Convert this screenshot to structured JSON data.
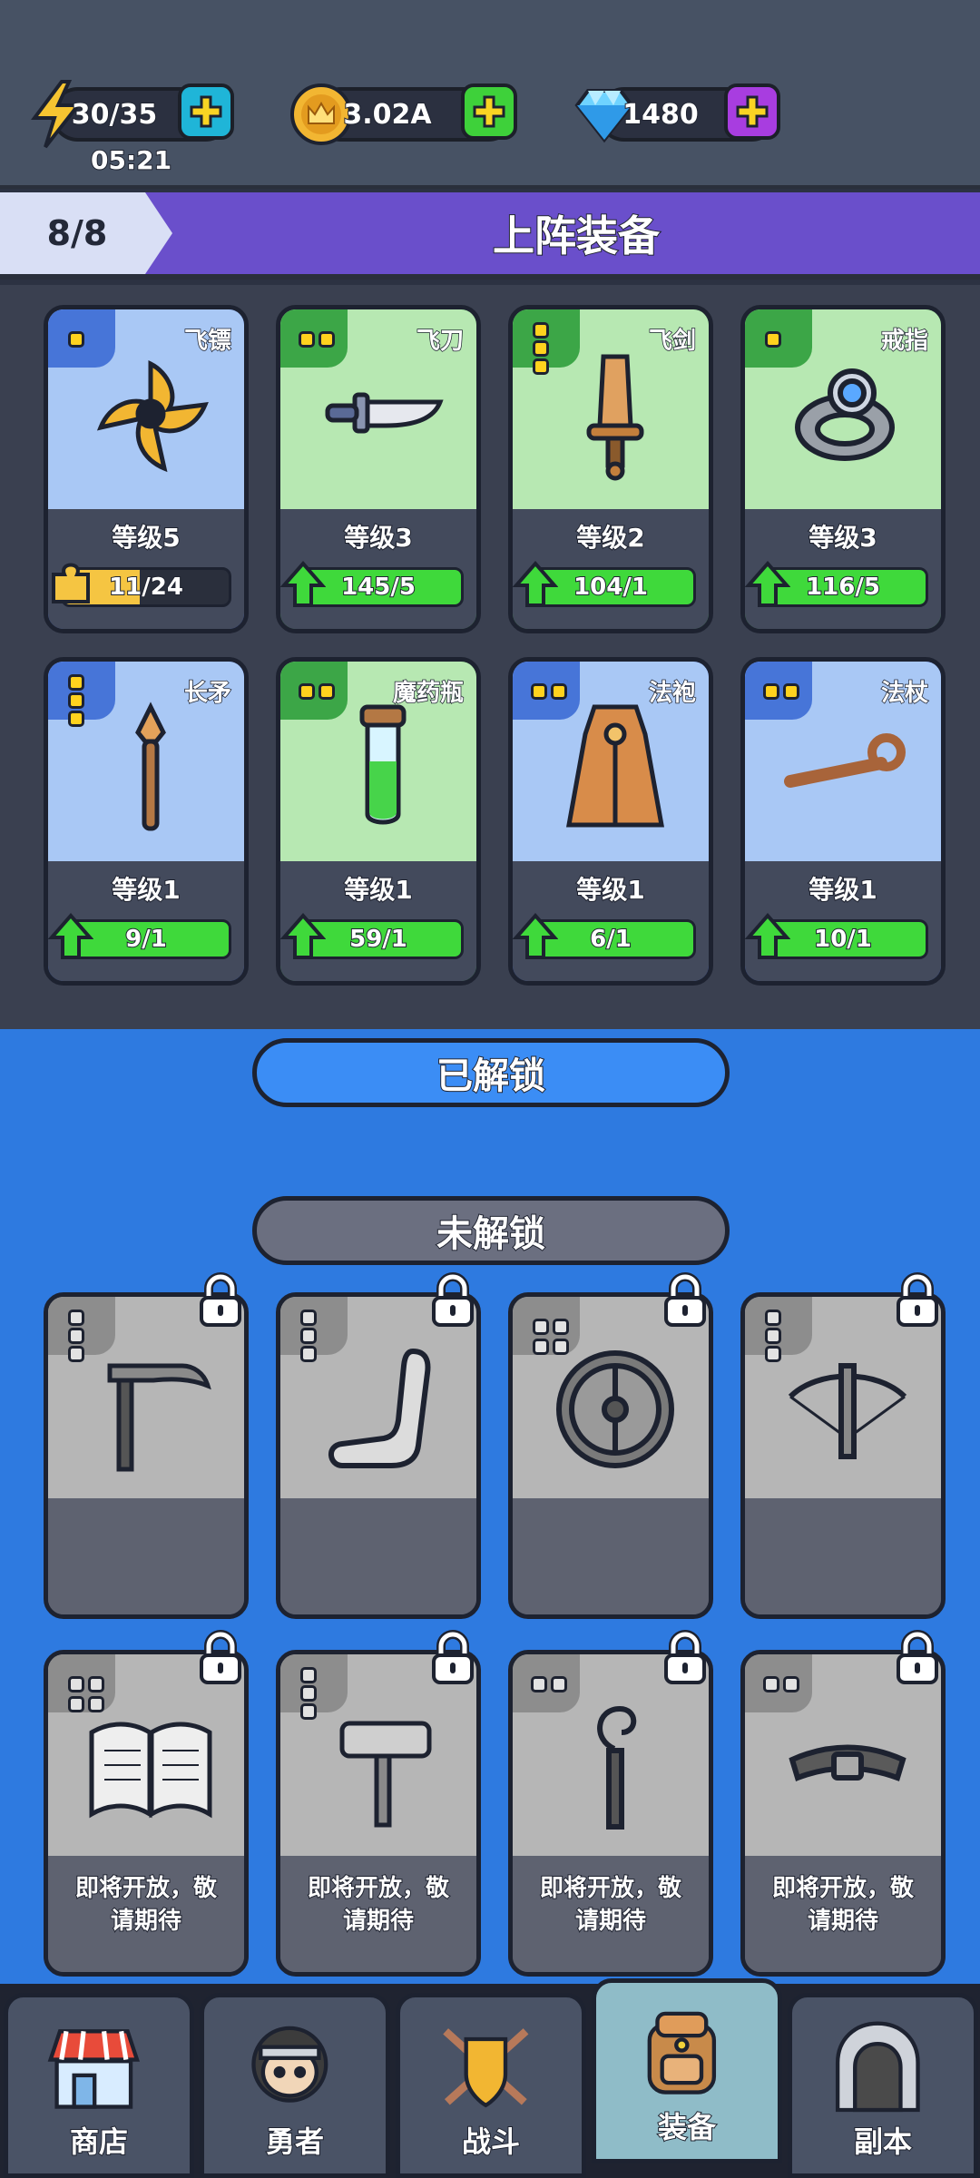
{
  "resources": {
    "energy": {
      "value": "30/35",
      "timer": "05:21",
      "icon": "lightning-icon"
    },
    "gold": {
      "value": "3.02A",
      "icon": "crown-coin-icon"
    },
    "gems": {
      "value": "1480",
      "icon": "diamond-icon"
    }
  },
  "equipped_section": {
    "count": "8/8",
    "title": "上阵装备"
  },
  "equipped_items": [
    {
      "name": "飞镖",
      "level": "等级5",
      "progress": "11/24",
      "progress_fraction": 0.46,
      "rarity": "blue",
      "pips": 1,
      "icon": "shuriken-icon",
      "bar": "yellow"
    },
    {
      "name": "飞刀",
      "level": "等级3",
      "progress": "145/5",
      "progress_fraction": 1.0,
      "rarity": "green",
      "pips": 2,
      "icon": "knife-icon",
      "bar": "green"
    },
    {
      "name": "飞剑",
      "level": "等级2",
      "progress": "104/1",
      "progress_fraction": 1.0,
      "rarity": "green",
      "pips": 3,
      "icon": "sword-icon",
      "bar": "green"
    },
    {
      "name": "戒指",
      "level": "等级3",
      "progress": "116/5",
      "progress_fraction": 1.0,
      "rarity": "green",
      "pips": 1,
      "icon": "ring-icon",
      "bar": "green"
    },
    {
      "name": "长矛",
      "level": "等级1",
      "progress": "9/1",
      "progress_fraction": 1.0,
      "rarity": "blue",
      "pips": 3,
      "icon": "spear-icon",
      "bar": "green"
    },
    {
      "name": "魔药瓶",
      "level": "等级1",
      "progress": "59/1",
      "progress_fraction": 1.0,
      "rarity": "green",
      "pips": 2,
      "icon": "potion-icon",
      "bar": "green"
    },
    {
      "name": "法袍",
      "level": "等级1",
      "progress": "6/1",
      "progress_fraction": 1.0,
      "rarity": "blue",
      "pips": 2,
      "icon": "robe-icon",
      "bar": "green"
    },
    {
      "name": "法杖",
      "level": "等级1",
      "progress": "10/1",
      "progress_fraction": 1.0,
      "rarity": "blue",
      "pips": 2,
      "icon": "staff-icon",
      "bar": "green"
    }
  ],
  "unlocked_label": "已解锁",
  "locked_label": "未解锁",
  "locked_items": [
    {
      "icon": "scythe-icon",
      "pips": 3,
      "soon": ""
    },
    {
      "icon": "boomerang-icon",
      "pips": 3,
      "soon": ""
    },
    {
      "icon": "shield-icon",
      "pips": 4,
      "soon": ""
    },
    {
      "icon": "crossbow-icon",
      "pips": 3,
      "soon": ""
    },
    {
      "icon": "book-icon",
      "pips": 4,
      "soon": "即将开放，敬\n请期待"
    },
    {
      "icon": "hammer-icon",
      "pips": 3,
      "soon": "即将开放，敬\n请期待"
    },
    {
      "icon": "wand-icon",
      "pips": 2,
      "soon": "即将开放，敬\n请期待"
    },
    {
      "icon": "belt-icon",
      "pips": 2,
      "soon": "即将开放，敬\n请期待"
    }
  ],
  "nav": [
    {
      "label": "商店",
      "icon": "shop-icon",
      "active": false
    },
    {
      "label": "勇者",
      "icon": "hero-icon",
      "active": false
    },
    {
      "label": "战斗",
      "icon": "battle-icon",
      "active": false
    },
    {
      "label": "装备",
      "icon": "backpack-icon",
      "active": true
    },
    {
      "label": "副本",
      "icon": "dungeon-icon",
      "active": false
    }
  ],
  "colors": {
    "accent_purple": "#6a4fcb",
    "progress_green": "#3fd93b",
    "progress_yellow": "#f5c542",
    "plus_yellow": "#f9d423",
    "plus_green": "#3ed13a",
    "plus_purple": "#a83de0"
  }
}
